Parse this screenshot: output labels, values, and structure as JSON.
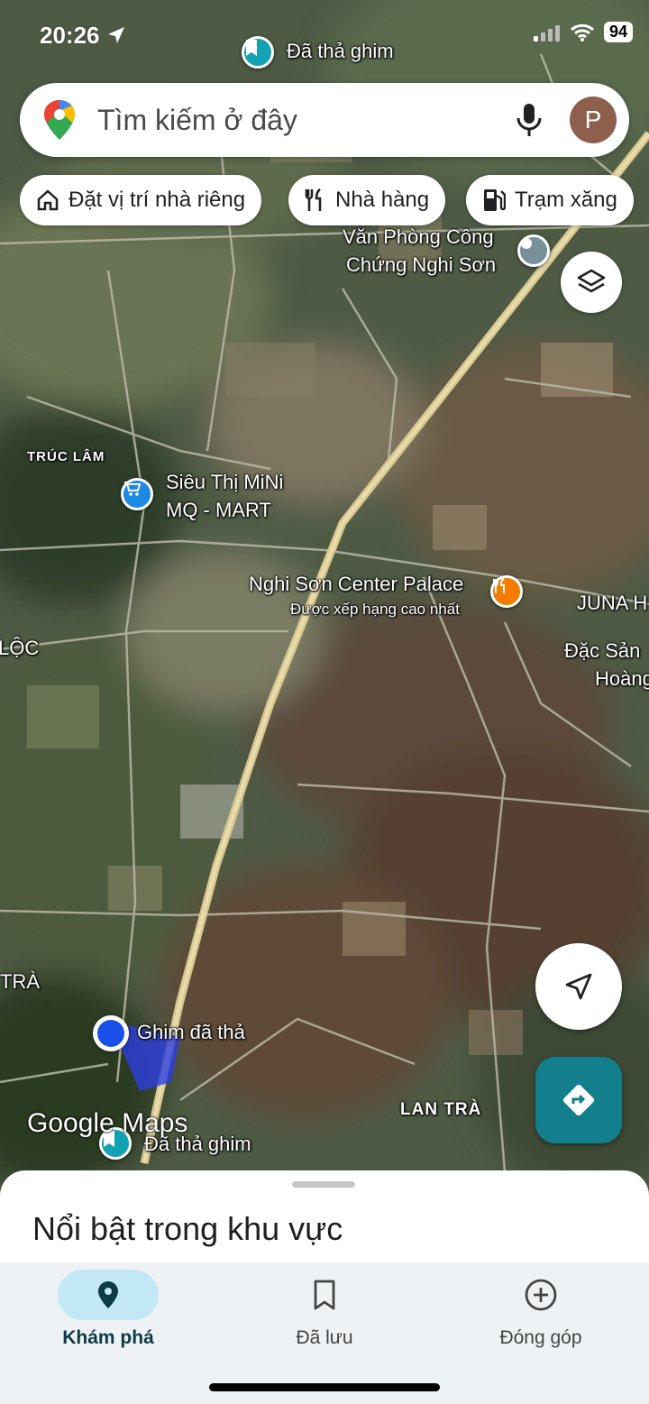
{
  "status_bar": {
    "time": "20:26",
    "battery": "94"
  },
  "search": {
    "placeholder": "Tìm kiếm ở đây",
    "avatar_letter": "P"
  },
  "chips": [
    {
      "label": "Đặt vị trí nhà riêng",
      "icon": "home-icon"
    },
    {
      "label": "Nhà hàng",
      "icon": "restaurant-icon"
    },
    {
      "label": "Trạm xăng",
      "icon": "gas-station-icon"
    }
  ],
  "map": {
    "labels": {
      "dropped_pin_top": "Đã thả ghim",
      "notary_line1": "Văn Phòng Công",
      "notary_line2": "Chứng Nghi Sơn",
      "truc_lam": "TRÚC LÂM",
      "mart_line1": "Siêu Thị MiNi",
      "mart_line2": "MQ - MART",
      "palace": "Nghi Sơn Center Palace",
      "palace_sub": "Được xếp hạng cao nhất",
      "juna": "JUNA H",
      "specialty_line1": "Đặc Sản",
      "specialty_line2": "Hoàng",
      "loc": "LỘC",
      "tra": "TRÀ",
      "pin_label": "Ghim đã thả",
      "lan_tra": "LAN TRÀ",
      "dropped_pin_bottom": "Đã thả ghim"
    },
    "watermark": "Google Maps"
  },
  "sheet": {
    "title": "Nổi bật trong khu vực"
  },
  "nav": [
    {
      "label": "Khám phá",
      "icon": "explore-pin-icon",
      "active": true
    },
    {
      "label": "Đã lưu",
      "icon": "bookmark-icon",
      "active": false
    },
    {
      "label": "Đóng góp",
      "icon": "add-circle-icon",
      "active": false
    }
  ],
  "colors": {
    "teal": "#137e8c",
    "pin_blue": "#1a73e8",
    "restaurant_orange": "#f57c00",
    "nav_active": "#c2e7f5"
  }
}
